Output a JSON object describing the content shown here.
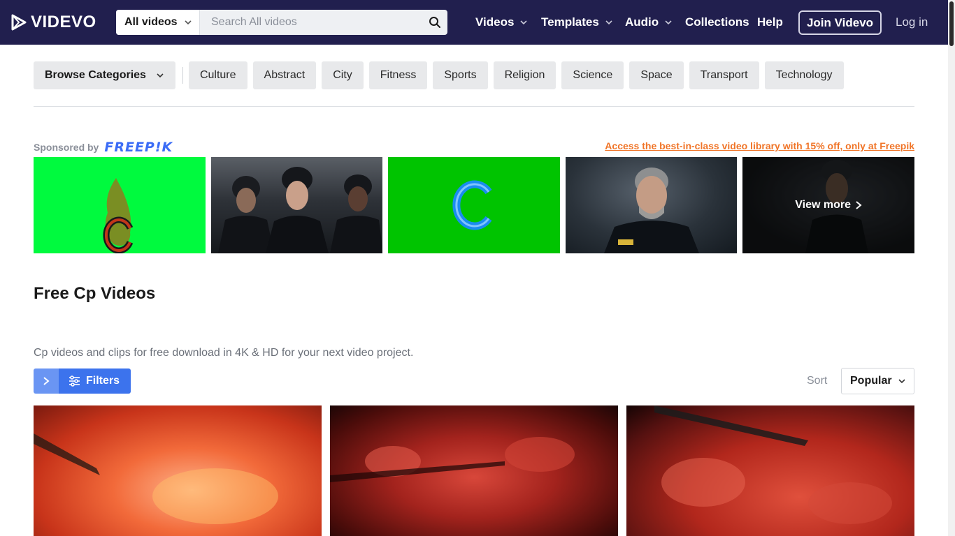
{
  "header": {
    "logo_text": "VIDEVO",
    "search": {
      "scope": "All videos",
      "placeholder": "Search All videos"
    },
    "nav": [
      {
        "label": "Videos",
        "has_dropdown": true
      },
      {
        "label": "Templates",
        "has_dropdown": true
      },
      {
        "label": "Audio",
        "has_dropdown": true
      },
      {
        "label": "Collections",
        "has_dropdown": false
      },
      {
        "label": "Help",
        "has_dropdown": false
      }
    ],
    "join_label": "Join Videvo",
    "login_label": "Log in"
  },
  "categories": {
    "browse_label": "Browse Categories",
    "items": [
      "Culture",
      "Abstract",
      "City",
      "Fitness",
      "Sports",
      "Religion",
      "Science",
      "Space",
      "Transport",
      "Technology"
    ]
  },
  "sponsored": {
    "label": "Sponsored by",
    "brand": "FREEP!K",
    "promo_text": "Access the best-in-class video library with 15% off, only at Freepik",
    "view_more_label": "View more"
  },
  "main": {
    "title": "Free Cp Videos",
    "description": "Cp videos and clips for free download in 4K & HD for your next video project.",
    "filters_label": "Filters",
    "sort_label": "Sort",
    "sort_value": "Popular"
  },
  "colors": {
    "nav_bg": "#211f4e",
    "accent_blue": "#3c73ed",
    "promo_orange": "#f07427",
    "freepik_blue": "#3b6cf6"
  }
}
